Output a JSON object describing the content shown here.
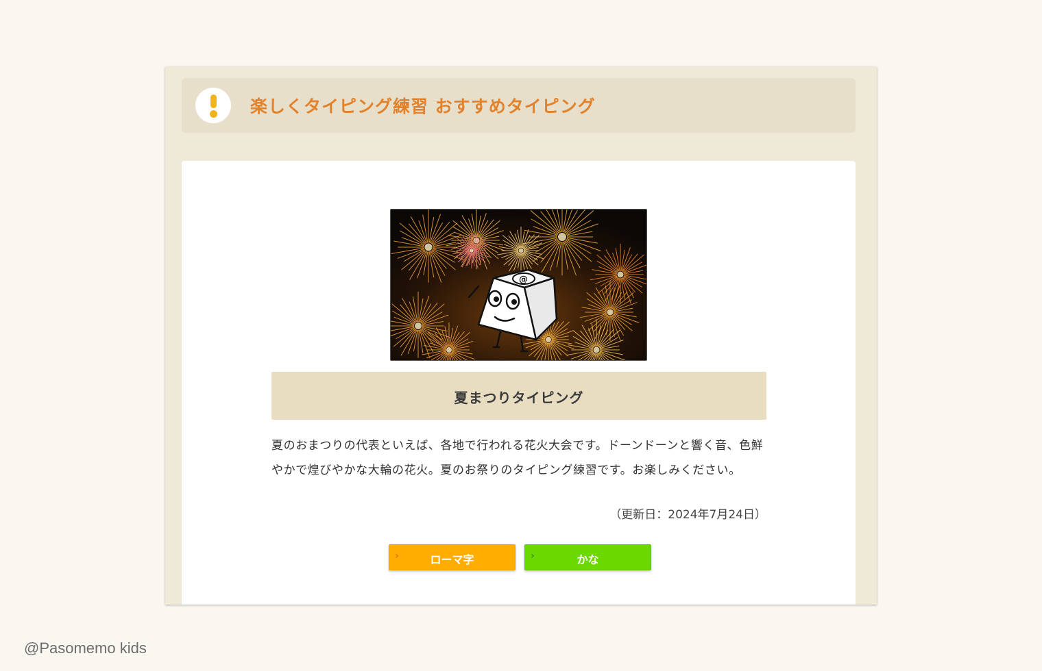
{
  "header": {
    "title": "楽しくタイピング練習 おすすめタイピング",
    "icon": "exclamation-icon"
  },
  "game": {
    "thumbnail_icon": "fireworks-keycap-mascot-image",
    "title": "夏まつりタイピング",
    "description": "夏のおまつりの代表といえば、各地で行われる花火大会です。ドーンドーンと響く音、色鮮やかで煌びやかな大輪の花火。夏のお祭りのタイピング練習です。お楽しみください。",
    "updated": "（更新日：2024年7月24日）"
  },
  "buttons": {
    "romaji_label": "ローマ字",
    "kana_label": "かな",
    "chevron": "›"
  },
  "credit": "@Pasomemo kids",
  "colors": {
    "page_bg": "#faf7f1",
    "panel_bg": "#efe9d8",
    "header_bg": "#e7dfca",
    "title_orange": "#e3822c",
    "alert_yellow": "#f0b41c",
    "romaji_button": "#ffad00",
    "kana_button": "#6bd800",
    "game_title_bg": "#e8ddc1"
  }
}
